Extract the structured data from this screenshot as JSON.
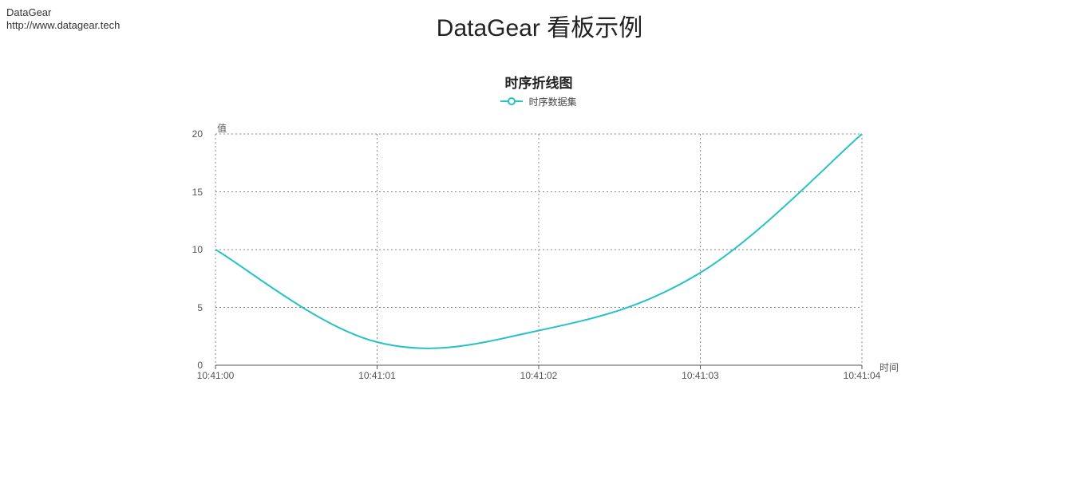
{
  "header": {
    "brand": "DataGear",
    "url": "http://www.datagear.tech",
    "page_title": "DataGear 看板示例"
  },
  "chart_data": {
    "type": "line",
    "title": "时序折线图",
    "legend": "时序数据集",
    "xlabel": "时间",
    "ylabel": "值",
    "ylim": [
      0,
      20
    ],
    "y_ticks": [
      0,
      5,
      10,
      15,
      20
    ],
    "x_ticks": [
      "10:41:00",
      "10:41:01",
      "10:41:02",
      "10:41:03",
      "10:41:04"
    ],
    "categories": [
      "10:41:00",
      "10:41:01",
      "10:41:02",
      "10:41:03",
      "10:41:04"
    ],
    "values": [
      10,
      2,
      3,
      8,
      20
    ],
    "series_color": "#26c2c5"
  }
}
